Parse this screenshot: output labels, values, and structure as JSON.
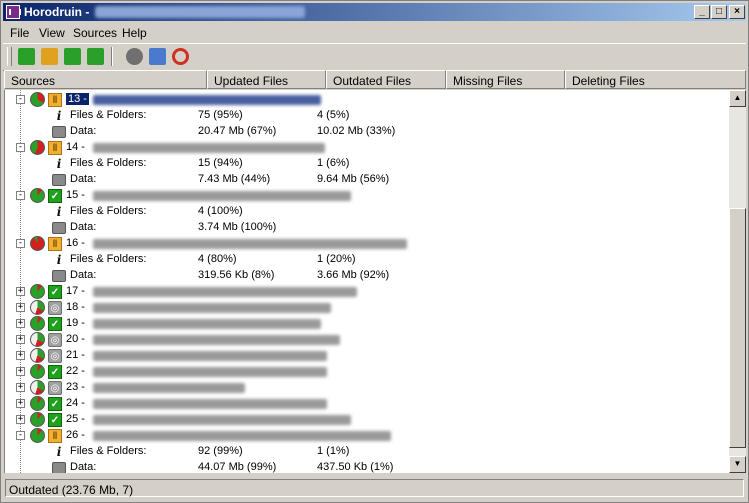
{
  "window": {
    "title": "Horodruin",
    "title_separator": "-",
    "buttons": {
      "minimize": "_",
      "maximize": "□",
      "close": "×"
    }
  },
  "menu": [
    "File",
    "View",
    "Sources",
    "Help"
  ],
  "toolbar": [
    {
      "name": "add-source-icon",
      "color": "#2aa02a"
    },
    {
      "name": "open-folder-icon",
      "color": "#e0a020"
    },
    {
      "name": "move-up-icon",
      "color": "#2aa02a"
    },
    {
      "name": "move-down-icon",
      "color": "#2aa02a"
    },
    {
      "name": "scan-icon",
      "color": "#707070"
    },
    {
      "name": "preview-icon",
      "color": "#4a7ad0"
    },
    {
      "name": "sync-icon",
      "color": "#d03020"
    }
  ],
  "columns": [
    "Sources",
    "Updated Files",
    "Outdated Files",
    "Missing Files",
    "Deleting Files"
  ],
  "sources": [
    {
      "num": "13 -",
      "expanded": true,
      "selected": true,
      "status": "pending",
      "pie": 0.33,
      "details": [
        {
          "label": "Files & Folders:",
          "updated": "75 (95%)",
          "outdated": "4 (5%)"
        },
        {
          "label": "Data:",
          "updated": "20.47 Mb (67%)",
          "outdated": "10.02 Mb (33%)"
        }
      ]
    },
    {
      "num": "14 -",
      "expanded": true,
      "status": "pending",
      "pie": 0.56,
      "details": [
        {
          "label": "Files & Folders:",
          "updated": "15 (94%)",
          "outdated": "1 (6%)"
        },
        {
          "label": "Data:",
          "updated": "7.43 Mb (44%)",
          "outdated": "9.64 Mb (56%)"
        }
      ]
    },
    {
      "num": "15 -",
      "expanded": true,
      "status": "ok",
      "pie": 0,
      "details": [
        {
          "label": "Files & Folders:",
          "updated": "4 (100%)",
          "outdated": ""
        },
        {
          "label": "Data:",
          "updated": "3.74 Mb (100%)",
          "outdated": ""
        }
      ]
    },
    {
      "num": "16 -",
      "expanded": true,
      "status": "pending",
      "pie": 0.92,
      "details": [
        {
          "label": "Files & Folders:",
          "updated": "4 (80%)",
          "outdated": "1 (20%)"
        },
        {
          "label": "Data:",
          "updated": "319.56 Kb (8%)",
          "outdated": "3.66 Mb (92%)"
        }
      ]
    },
    {
      "num": "17 -",
      "expanded": false,
      "status": "ok",
      "pie": 0
    },
    {
      "num": "18 -",
      "expanded": false,
      "status": "idle",
      "pie": 0
    },
    {
      "num": "19 -",
      "expanded": false,
      "status": "ok",
      "pie": 0
    },
    {
      "num": "20 -",
      "expanded": false,
      "status": "idle",
      "pie": 0
    },
    {
      "num": "21 -",
      "expanded": false,
      "status": "idle",
      "pie": 0
    },
    {
      "num": "22 -",
      "expanded": false,
      "status": "ok",
      "pie": 0
    },
    {
      "num": "23 -",
      "expanded": false,
      "status": "idle",
      "pie": 0
    },
    {
      "num": "24 -",
      "expanded": false,
      "status": "ok",
      "pie": 0
    },
    {
      "num": "25 -",
      "expanded": false,
      "status": "ok",
      "pie": 0
    },
    {
      "num": "26 -",
      "expanded": true,
      "status": "pending",
      "pie": 0.01,
      "details": [
        {
          "label": "Files & Folders:",
          "updated": "92 (99%)",
          "outdated": "1 (1%)"
        },
        {
          "label": "Data:",
          "updated": "44.07 Mb (99%)",
          "outdated": "437.50 Kb (1%)"
        }
      ]
    }
  ],
  "colors": {
    "pie_updated": "#2aa02a",
    "pie_outdated": "#d02020",
    "selection": "#0a246a"
  },
  "status_bar": "Outdated (23.76 Mb, 7)"
}
